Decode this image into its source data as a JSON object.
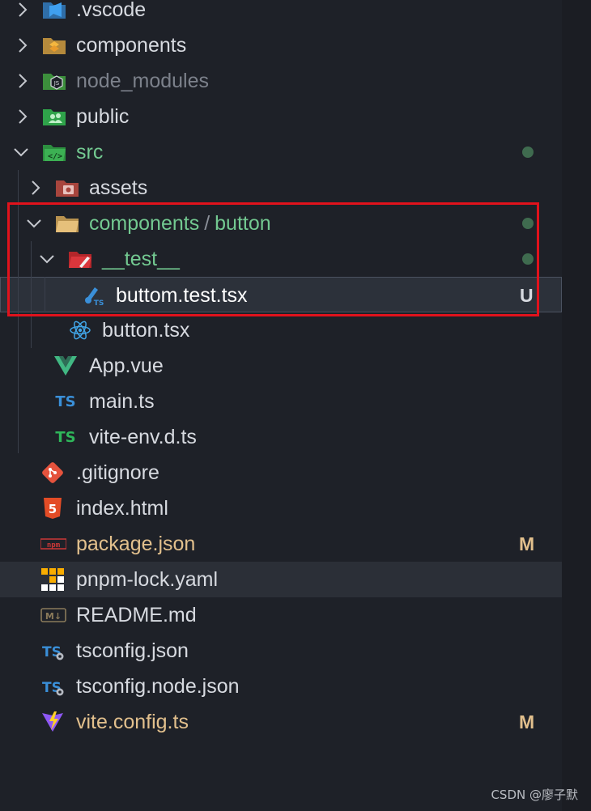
{
  "explorer": {
    "items": [
      {
        "label": "components",
        "color": "#d7dae0",
        "icon": "folder-components-icon"
      },
      {
        "label": "node_modules",
        "color": "#7c818b",
        "icon": "folder-node-icon"
      },
      {
        "label": "public",
        "color": "#d7dae0",
        "icon": "folder-public-icon"
      },
      {
        "label": "src",
        "color": "#73c991",
        "icon": "folder-src-icon"
      },
      {
        "label": "assets",
        "color": "#d7dae0",
        "icon": "folder-assets-icon"
      },
      {
        "label_a": "components",
        "separator": "/",
        "label_b": "button",
        "color": "#73c991",
        "icon": "folder-open-icon"
      },
      {
        "label": "__test__",
        "color": "#73c991",
        "icon": "folder-test-icon"
      },
      {
        "label": "buttom.test.tsx",
        "color": "#ffffff",
        "icon": "test-tsx-icon",
        "badge": "U"
      },
      {
        "label": "button.tsx",
        "color": "#d7dae0",
        "icon": "react-icon"
      },
      {
        "label": "App.vue",
        "color": "#d7dae0",
        "icon": "vue-icon"
      },
      {
        "label": "main.ts",
        "color": "#d7dae0",
        "icon": "typescript-icon",
        "icon_text": "TS"
      },
      {
        "label": "vite-env.d.ts",
        "color": "#d7dae0",
        "icon": "typescript-def-icon",
        "icon_text": "TS"
      },
      {
        "label": ".gitignore",
        "color": "#d7dae0",
        "icon": "git-icon"
      },
      {
        "label": "index.html",
        "color": "#d7dae0",
        "icon": "html5-icon",
        "icon_text": "5"
      },
      {
        "label": "package.json",
        "color": "#e2c08d",
        "icon": "npm-icon",
        "icon_text": "npm",
        "badge": "M"
      },
      {
        "label": "pnpm-lock.yaml",
        "color": "#d7dae0",
        "icon": "pnpm-icon"
      },
      {
        "label": "README.md",
        "color": "#d7dae0",
        "icon": "markdown-icon",
        "icon_text": "M↓"
      },
      {
        "label": "tsconfig.json",
        "color": "#d7dae0",
        "icon": "tsconfig-icon",
        "icon_text": "TS"
      },
      {
        "label": "tsconfig.node.json",
        "color": "#d7dae0",
        "icon": "tsconfig-icon",
        "icon_text": "TS"
      },
      {
        "label": "vite.config.ts",
        "color": "#e2c08d",
        "icon": "vite-icon",
        "badge": "M"
      }
    ],
    "top_partial_label": ".vscode"
  },
  "watermark": "CSDN @廖子默",
  "colors": {
    "background": "#1e2128",
    "untracked_green": "#73c991",
    "modified_yellow": "#e2c08d",
    "highlight_red": "#e1121c"
  }
}
